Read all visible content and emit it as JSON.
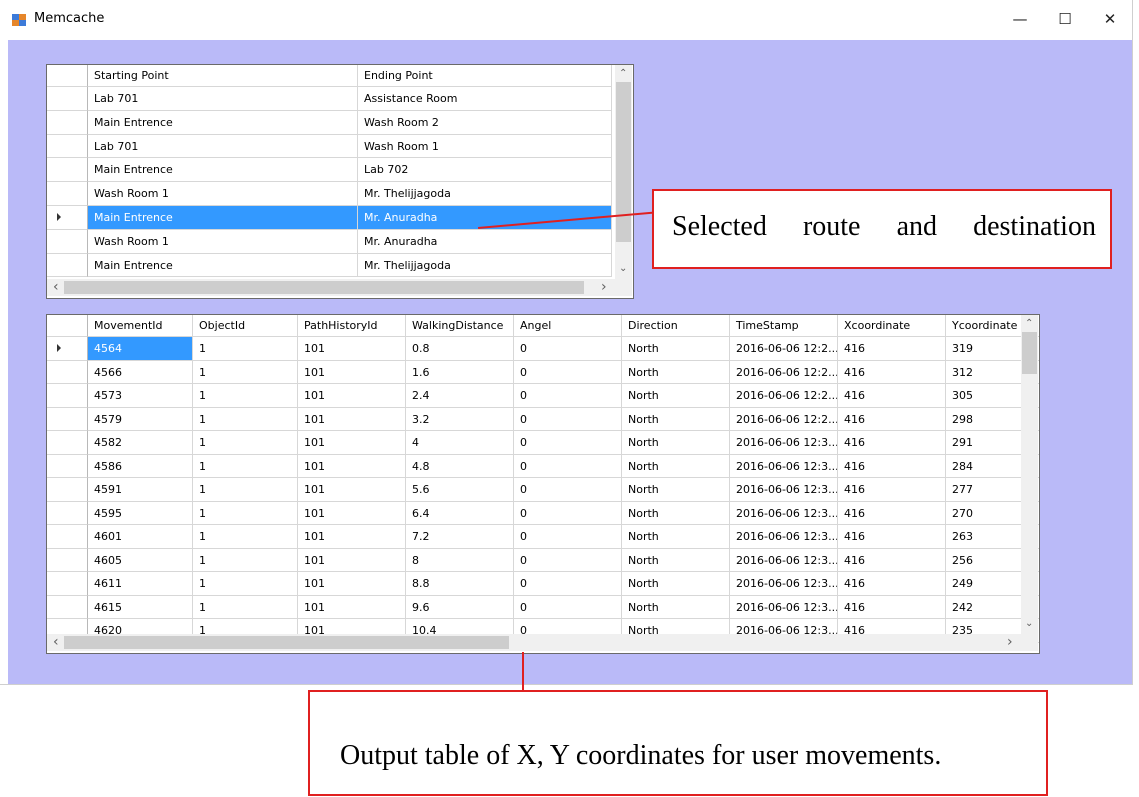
{
  "window": {
    "title": "Memcache"
  },
  "controls": {
    "minimize": "—",
    "maximize": "☐",
    "close": "✕"
  },
  "routes": {
    "columns": [
      "Starting Point",
      "Ending Point"
    ],
    "rows": [
      [
        "Lab 701",
        "Assistance Room"
      ],
      [
        "Main Entrence",
        "Wash Room 2"
      ],
      [
        "Lab 701",
        "Wash Room 1"
      ],
      [
        "Main Entrence",
        "Lab 702"
      ],
      [
        "Wash Room 1",
        "Mr. Thelijjagoda"
      ],
      [
        "Main Entrence",
        "Mr. Anuradha"
      ],
      [
        "Wash Room 1",
        "Mr. Anuradha"
      ],
      [
        "Main Entrence",
        "Mr. Thelijjagoda"
      ]
    ],
    "selected_row": 5
  },
  "movements": {
    "columns": [
      "MovementId",
      "ObjectId",
      "PathHistoryId",
      "WalkingDistance",
      "Angel",
      "Direction",
      "TimeStamp",
      "Xcoordinate",
      "Ycoordinate"
    ],
    "rows": [
      [
        "4564",
        "1",
        "101",
        "0.8",
        "0",
        "North",
        "2016-06-06 12:2...",
        "416",
        "319"
      ],
      [
        "4566",
        "1",
        "101",
        "1.6",
        "0",
        "North",
        "2016-06-06 12:2...",
        "416",
        "312"
      ],
      [
        "4573",
        "1",
        "101",
        "2.4",
        "0",
        "North",
        "2016-06-06 12:2...",
        "416",
        "305"
      ],
      [
        "4579",
        "1",
        "101",
        "3.2",
        "0",
        "North",
        "2016-06-06 12:2...",
        "416",
        "298"
      ],
      [
        "4582",
        "1",
        "101",
        "4",
        "0",
        "North",
        "2016-06-06 12:3...",
        "416",
        "291"
      ],
      [
        "4586",
        "1",
        "101",
        "4.8",
        "0",
        "North",
        "2016-06-06 12:3...",
        "416",
        "284"
      ],
      [
        "4591",
        "1",
        "101",
        "5.6",
        "0",
        "North",
        "2016-06-06 12:3...",
        "416",
        "277"
      ],
      [
        "4595",
        "1",
        "101",
        "6.4",
        "0",
        "North",
        "2016-06-06 12:3...",
        "416",
        "270"
      ],
      [
        "4601",
        "1",
        "101",
        "7.2",
        "0",
        "North",
        "2016-06-06 12:3...",
        "416",
        "263"
      ],
      [
        "4605",
        "1",
        "101",
        "8",
        "0",
        "North",
        "2016-06-06 12:3...",
        "416",
        "256"
      ],
      [
        "4611",
        "1",
        "101",
        "8.8",
        "0",
        "North",
        "2016-06-06 12:3...",
        "416",
        "249"
      ],
      [
        "4615",
        "1",
        "101",
        "9.6",
        "0",
        "North",
        "2016-06-06 12:3...",
        "416",
        "242"
      ],
      [
        "4620",
        "1",
        "101",
        "10.4",
        "0",
        "North",
        "2016-06-06 12:3...",
        "416",
        "235"
      ]
    ],
    "current_row": 0
  },
  "annotations": {
    "selected_route": [
      "Selected",
      "route",
      "and",
      "destination"
    ],
    "output_table": "Output table of X, Y coordinates for user movements."
  },
  "colors": {
    "client_bg": "#babaf8",
    "selection": "#3399ff",
    "callout_border": "#e02020"
  }
}
